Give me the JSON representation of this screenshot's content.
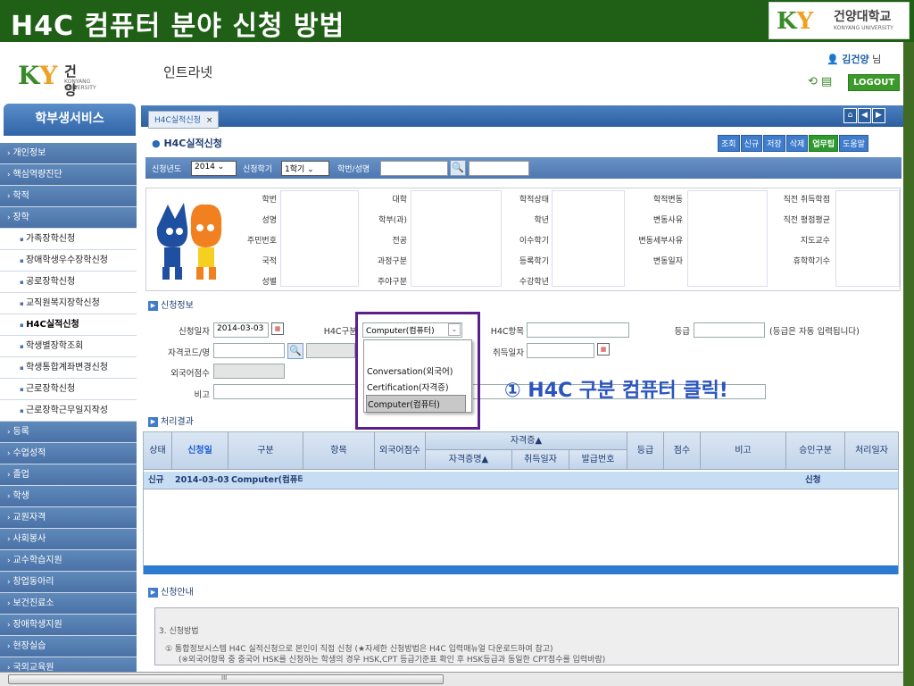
{
  "slide": {
    "title": "H4C 컴퓨터 분야 신청 방법",
    "logo_ky": "KY",
    "logo_kr": "건양대학교",
    "logo_en": "KONYANG UNIVERSITY"
  },
  "header": {
    "logo_ky": "KY",
    "logo_kr": "건양대학교",
    "logo_en": "KONYANG UNIVERSITY",
    "intranet": "인트라넷",
    "user_name": "김건양",
    "user_suffix": "님",
    "logout": "LOGOUT"
  },
  "sidebar": {
    "title": "학부생서비스",
    "items": [
      {
        "label": "개인정보",
        "type": "cat"
      },
      {
        "label": "핵심역량진단",
        "type": "cat"
      },
      {
        "label": "학적",
        "type": "cat"
      },
      {
        "label": "장학",
        "type": "cat"
      },
      {
        "label": "가족장학신청",
        "type": "sub"
      },
      {
        "label": "장애학생우수장학신청",
        "type": "sub"
      },
      {
        "label": "공로장학신청",
        "type": "sub"
      },
      {
        "label": "교직원복지장학신청",
        "type": "sub"
      },
      {
        "label": "H4C실적신청",
        "type": "sub",
        "active": true
      },
      {
        "label": "학생별장학조회",
        "type": "sub"
      },
      {
        "label": "학생통합계좌변경신청",
        "type": "sub"
      },
      {
        "label": "근로장학신청",
        "type": "sub"
      },
      {
        "label": "근로장학근무일지작성",
        "type": "sub"
      },
      {
        "label": "등록",
        "type": "cat"
      },
      {
        "label": "수업성적",
        "type": "cat"
      },
      {
        "label": "졸업",
        "type": "cat"
      },
      {
        "label": "학생",
        "type": "cat"
      },
      {
        "label": "교원자격",
        "type": "cat"
      },
      {
        "label": "사회봉사",
        "type": "cat"
      },
      {
        "label": "교수학습지원",
        "type": "cat"
      },
      {
        "label": "창업동아리",
        "type": "cat"
      },
      {
        "label": "보건진료소",
        "type": "cat"
      },
      {
        "label": "장애학생지원",
        "type": "cat"
      },
      {
        "label": "현장실습",
        "type": "cat"
      },
      {
        "label": "국외교육원",
        "type": "cat"
      }
    ]
  },
  "tab": {
    "label": "H4C실적신청",
    "close": "×"
  },
  "page": {
    "title": "H4C실적신청",
    "buttons": [
      "조회",
      "신규",
      "저장",
      "삭제",
      "업무팁",
      "도움말"
    ]
  },
  "filter": {
    "year_label": "신청년도",
    "year": "2014",
    "term_label": "신청학기",
    "term": "1학기",
    "id_label": "학번/성명"
  },
  "info": {
    "labels": [
      [
        "학번",
        "성명",
        "주민번호",
        "국적",
        "성별"
      ],
      [
        "대학",
        "학부(과)",
        "전공",
        "과정구분",
        "주야구분"
      ],
      [
        "학적상태",
        "학년",
        "이수학기",
        "등록학기",
        "수강학년"
      ],
      [
        "학적변동",
        "변동사유",
        "변동세부사유",
        "변동일자",
        ""
      ],
      [
        "직전 취득학점",
        "직전 평점평균",
        "지도교수",
        "휴학학기수",
        ""
      ]
    ]
  },
  "section_apply": "신청정보",
  "form": {
    "date_label": "신청일자",
    "date": "2014-03-03",
    "h4c_label": "H4C구분",
    "h4c_value": "Computer(컴퓨터)",
    "item_label": "H4C항목",
    "grade_label": "등급",
    "grade_note": "(등급은 자동 입력됩니다)",
    "cert_label": "자격코드/명",
    "acq_label": "취득일자",
    "foreign_label": "외국어점수",
    "note_label": "비고"
  },
  "dropdown": {
    "options": [
      "",
      "Conversation(외국어)",
      "Certification(자격증)",
      "Computer(컴퓨터)"
    ],
    "selected": "Computer(컴퓨터)"
  },
  "callout": "① H4C 구분 컴퓨터 클릭!",
  "section_result": "처리결과",
  "grid": {
    "headers": [
      "상태",
      "신청일",
      "구분",
      "항목",
      "외국어점수",
      "자격증▲",
      "자격증명▲",
      "취득일자",
      "발급번호",
      "등급",
      "점수",
      "비고",
      "승인구분",
      "처리일자"
    ],
    "row": {
      "status": "신규",
      "date": "2014-03-03",
      "type": "Computer(컴퓨터",
      "approval": "신청"
    }
  },
  "section_guide": "신청안내",
  "guide": {
    "heading": "3. 신청방법",
    "line1": "① 통합정보시스템 H4C 실적신청으로 본인이 직접 신청 (★자세한 신청방법은 H4C 입력매뉴얼 다운로드하여 참고)",
    "line2": "(※외국어항목 중 중국어 HSK를 신청하는 학생의 경우 HSK,CPT 등급기준표 확인 후 HSK등급과 동일한 CPT점수를 입력바람)"
  },
  "scrollbar": {
    "grip": "III"
  }
}
